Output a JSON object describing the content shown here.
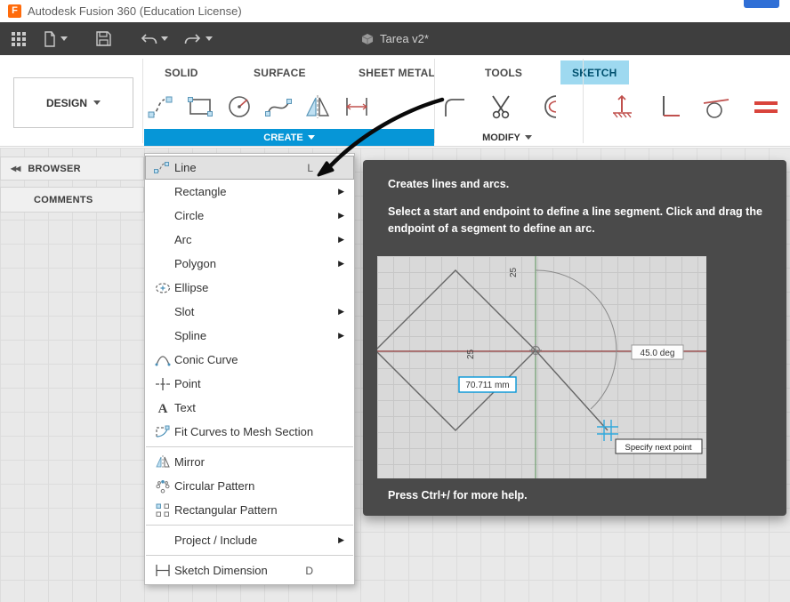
{
  "titlebar": {
    "app_title": "Autodesk Fusion 360 (Education License)"
  },
  "topbar": {
    "document_title": "Tarea v2*"
  },
  "ribbon": {
    "design_label": "DESIGN",
    "create_label": "CREATE",
    "modify_label": "MODIFY",
    "tabs": [
      {
        "label": "SOLID"
      },
      {
        "label": "SURFACE"
      },
      {
        "label": "SHEET METAL"
      },
      {
        "label": "TOOLS"
      },
      {
        "label": "SKETCH",
        "active": true
      }
    ]
  },
  "sidebar": {
    "browser": "BROWSER",
    "comments": "COMMENTS"
  },
  "menu": {
    "items": [
      {
        "label": "Line",
        "shortcut": "L",
        "icon": "line-icon",
        "highlighted": true
      },
      {
        "label": "Rectangle",
        "submenu": true
      },
      {
        "label": "Circle",
        "submenu": true
      },
      {
        "label": "Arc",
        "submenu": true
      },
      {
        "label": "Polygon",
        "submenu": true
      },
      {
        "label": "Ellipse",
        "icon": "ellipse-icon"
      },
      {
        "label": "Slot",
        "submenu": true
      },
      {
        "label": "Spline",
        "submenu": true
      },
      {
        "label": "Conic Curve",
        "icon": "conic-curve-icon"
      },
      {
        "label": "Point",
        "icon": "point-icon"
      },
      {
        "label": "Text",
        "icon": "text-icon"
      },
      {
        "label": "Fit Curves to Mesh Section",
        "icon": "fit-curves-icon"
      },
      {
        "label": "Mirror",
        "icon": "mirror-icon"
      },
      {
        "label": "Circular Pattern",
        "icon": "circular-pattern-icon"
      },
      {
        "label": "Rectangular Pattern",
        "icon": "rectangular-pattern-icon"
      },
      {
        "label": "Project / Include",
        "submenu": true
      },
      {
        "label": "Sketch Dimension",
        "shortcut": "D",
        "icon": "sketch-dimension-icon"
      }
    ]
  },
  "tooltip": {
    "title": "Creates lines and arcs.",
    "body": "Select a start and endpoint to define a line segment. Click and drag the endpoint of a segment to define an arc.",
    "footer": "Press Ctrl+/ for more help.",
    "preview": {
      "dim_top": "25",
      "dim_left": "25",
      "length_value": "70.711 mm",
      "angle_value": "45.0 deg",
      "hint": "Specify next point"
    }
  },
  "glyphs": {
    "submenu": "▶",
    "collapse": "◀◀"
  },
  "colors": {
    "accent_blue": "#0696d7",
    "tab_highlight": "#9ed9f0",
    "tooltip_bg": "#4a4a4a",
    "toolbar_bg": "#3e3e3e",
    "constraint_red": "#c0504d",
    "logo_orange": "#ff6b0b"
  }
}
